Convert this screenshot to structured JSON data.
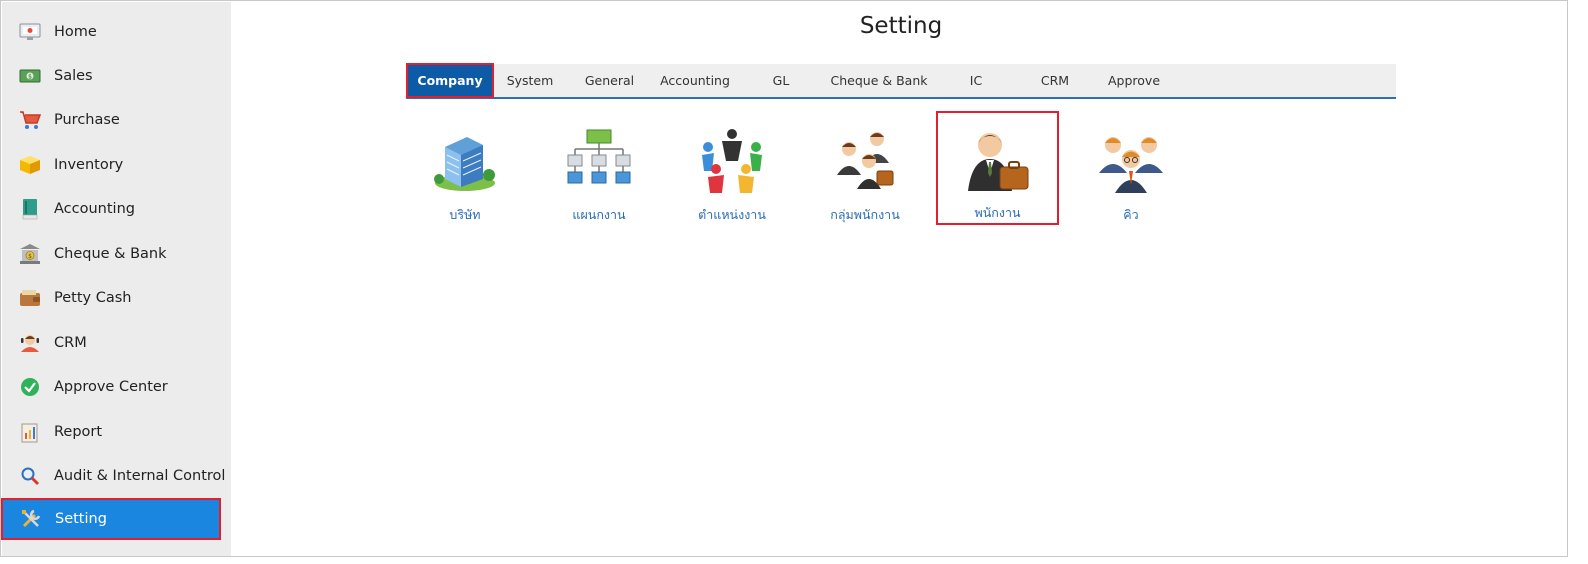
{
  "sidebar": {
    "items": [
      {
        "label": "Home",
        "icon": "home-icon"
      },
      {
        "label": "Sales",
        "icon": "money-icon"
      },
      {
        "label": "Purchase",
        "icon": "cart-icon"
      },
      {
        "label": "Inventory",
        "icon": "box-icon"
      },
      {
        "label": "Accounting",
        "icon": "ledger-book-icon"
      },
      {
        "label": "Cheque & Bank",
        "icon": "bank-icon"
      },
      {
        "label": "Petty Cash",
        "icon": "wallet-icon"
      },
      {
        "label": "CRM",
        "icon": "customer-icon"
      },
      {
        "label": "Approve Center",
        "icon": "check-circle-icon"
      },
      {
        "label": "Report",
        "icon": "report-icon"
      },
      {
        "label": "Audit & Internal Control",
        "icon": "magnifier-icon"
      },
      {
        "label": "Setting",
        "icon": "tools-icon"
      }
    ],
    "active": "Setting"
  },
  "main": {
    "title": "Setting",
    "tabs": [
      {
        "label": "Company"
      },
      {
        "label": "System"
      },
      {
        "label": "General"
      },
      {
        "label": "Accounting"
      },
      {
        "label": "GL"
      },
      {
        "label": "Cheque & Bank"
      },
      {
        "label": "IC"
      },
      {
        "label": "CRM"
      },
      {
        "label": "Approve"
      }
    ],
    "active_tab": "Company",
    "tiles": [
      {
        "label": "บริษัท",
        "icon": "company-building-icon"
      },
      {
        "label": "แผนกงาน",
        "icon": "department-chart-icon"
      },
      {
        "label": "ตำแหน่งงาน",
        "icon": "position-people-icon"
      },
      {
        "label": "กลุ่มพนักงาน",
        "icon": "employee-group-icon"
      },
      {
        "label": "พนักงาน",
        "icon": "employee-icon"
      },
      {
        "label": "คิว",
        "icon": "queue-people-icon"
      }
    ],
    "highlighted_tile": "พนักงาน"
  },
  "colors": {
    "accent": "#1a86e0",
    "tab_active": "#0d5aa7",
    "highlight_border": "#e01f2f",
    "link": "#2a6db5"
  }
}
